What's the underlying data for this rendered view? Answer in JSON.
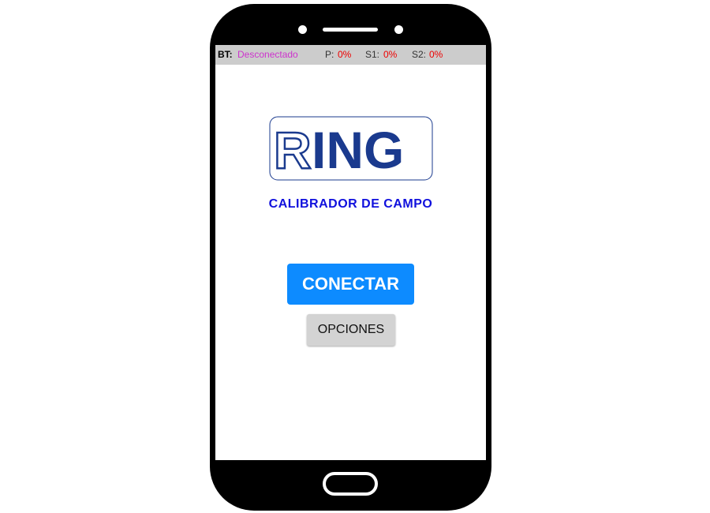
{
  "status_bar": {
    "bt_label": "BT:",
    "bt_value": "Desconectado",
    "p_label": "P:",
    "p_value": "0%",
    "s1_label": "S1:",
    "s1_value": "0%",
    "s2_label": "S2:",
    "s2_value": "0%"
  },
  "logo": {
    "text": "RING",
    "icon": "ring-logo"
  },
  "subtitle": "CALIBRADOR DE CAMPO",
  "buttons": {
    "conectar": "CONECTAR",
    "opciones": "OPCIONES"
  },
  "colors": {
    "status_disconnected": "#cc33cc",
    "status_percent": "#ee0000",
    "logo_navy": "#1a3a8e",
    "subtitle": "#1010dd",
    "conectar_bg": "#0d8bff"
  }
}
